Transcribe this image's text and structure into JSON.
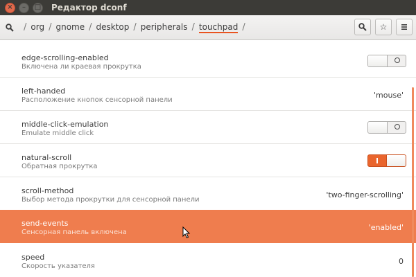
{
  "window": {
    "title": "Редактор dconf"
  },
  "breadcrumb": {
    "items": [
      "org",
      "gnome",
      "desktop",
      "peripherals",
      "touchpad"
    ],
    "separator": "/"
  },
  "icons": {
    "search": "search-icon",
    "bookmark": "star-icon",
    "menu": "hamburger-menu-icon"
  },
  "keys": [
    {
      "name": "edge-scrolling-enabled",
      "desc": "Включена ли краевая прокрутка",
      "type": "switch",
      "state": "off"
    },
    {
      "name": "left-handed",
      "desc": "Расположение кнопок сенсорной панели",
      "type": "value",
      "value": "'mouse'"
    },
    {
      "name": "middle-click-emulation",
      "desc": "Emulate middle click",
      "type": "switch",
      "state": "off"
    },
    {
      "name": "natural-scroll",
      "desc": "Обратная прокрутка",
      "type": "switch",
      "state": "on"
    },
    {
      "name": "scroll-method",
      "desc": "Выбор метода прокрутки для сенсорной панели",
      "type": "value",
      "value": "'two-finger-scrolling'"
    },
    {
      "name": "send-events",
      "desc": "Сенсорная панель включена",
      "type": "value",
      "value": "'enabled'",
      "selected": true
    },
    {
      "name": "speed",
      "desc": "Скорость указателя",
      "type": "value",
      "value": "0"
    }
  ],
  "colors": {
    "accent": "#e95420",
    "selected_row": "#ef7d4e",
    "titlebar": "#3c3b37"
  }
}
